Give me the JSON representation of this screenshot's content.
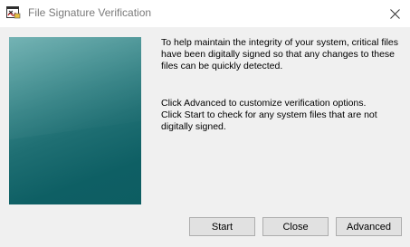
{
  "window": {
    "title": "File Signature Verification",
    "app_icon": "signature-verification-icon",
    "close_icon": "close-icon"
  },
  "content": {
    "paragraph1": "To help maintain the integrity of your system, critical files have been digitally signed so that any changes to these files can be quickly detected.",
    "paragraph2_line1": "Click Advanced to customize verification options.",
    "paragraph2_line2": "Click Start to check for any system files that are not digitally signed."
  },
  "buttons": {
    "start": "Start",
    "close": "Close",
    "advanced": "Advanced"
  },
  "colors": {
    "banner_top": "#5aa5a6",
    "banner_bottom": "#0d5d62",
    "window_bg": "#f0f0f0",
    "button_bg": "#e1e1e1",
    "button_border": "#adadad"
  }
}
